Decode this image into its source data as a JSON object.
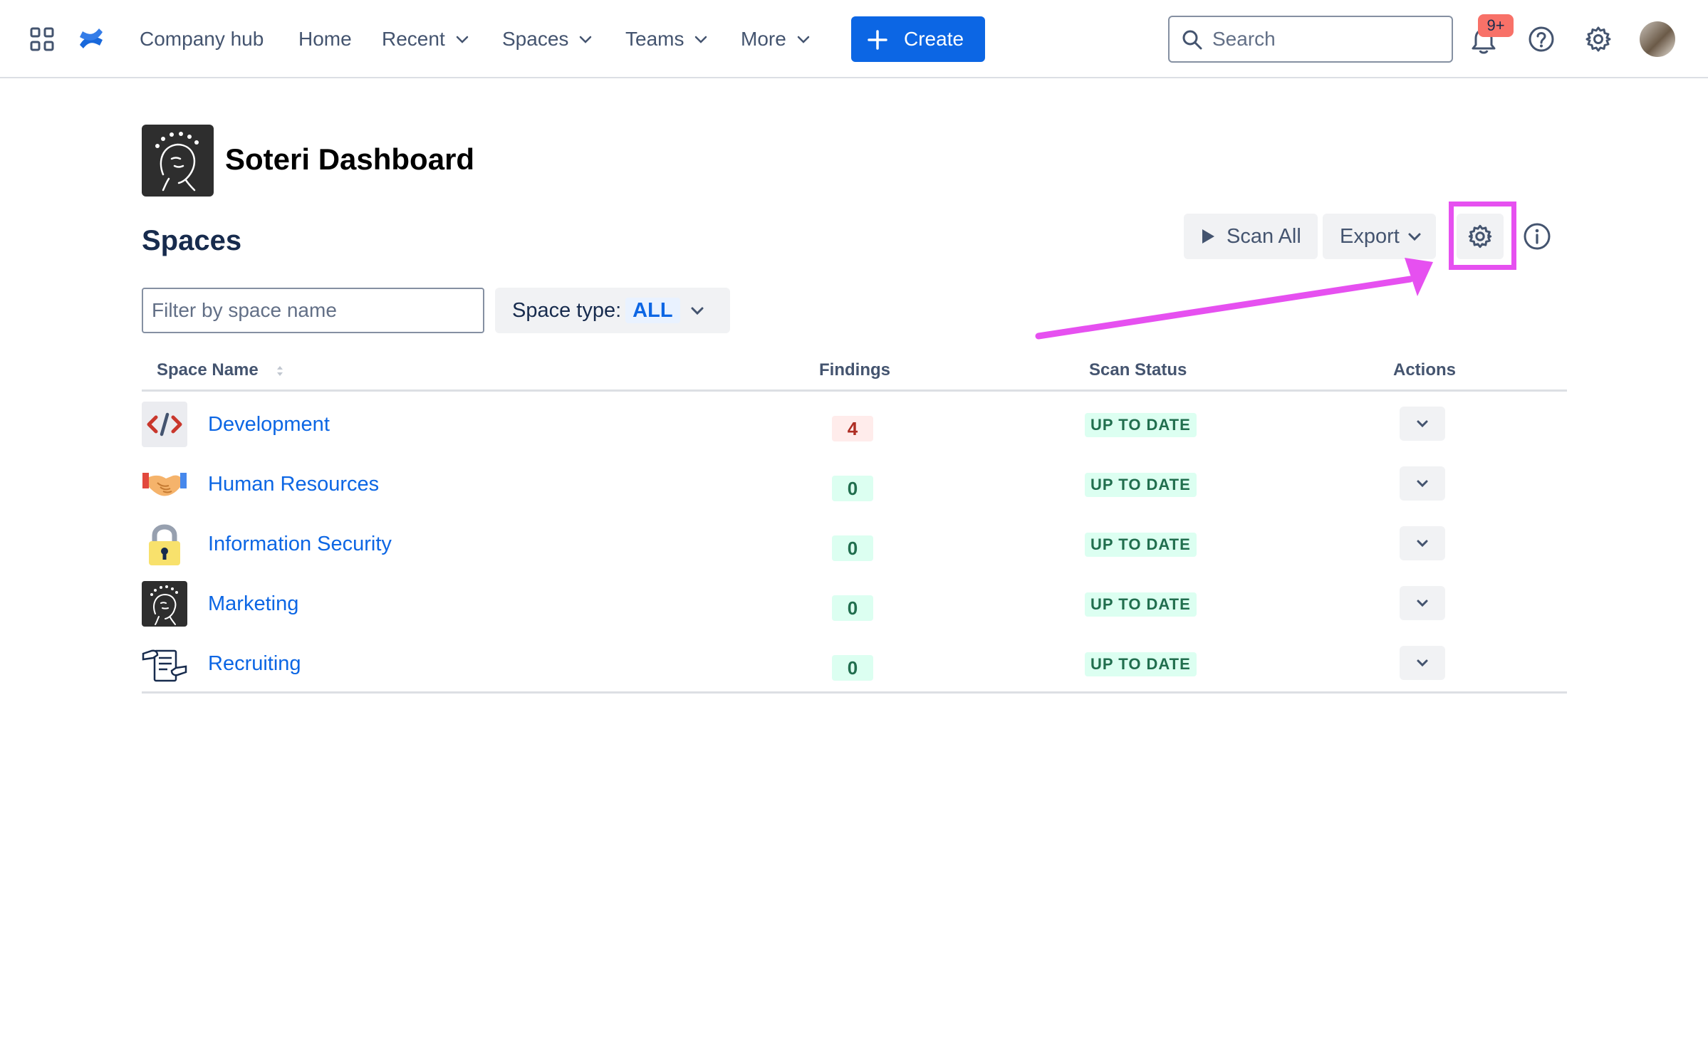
{
  "nav": {
    "app_switcher_icon": "grid-icon",
    "logo_icon": "confluence-logo-icon",
    "links": [
      {
        "label": "Company hub",
        "has_chevron": false
      },
      {
        "label": "Home",
        "has_chevron": false
      },
      {
        "label": "Recent",
        "has_chevron": true
      },
      {
        "label": "Spaces",
        "has_chevron": true
      },
      {
        "label": "Teams",
        "has_chevron": true
      },
      {
        "label": "More",
        "has_chevron": true
      }
    ],
    "create_label": "Create",
    "search_placeholder": "Search",
    "notifications_badge": "9+",
    "colors": {
      "primary": "#0c66e4",
      "badge": "#f87168"
    }
  },
  "header": {
    "title": "Soteri Dashboard",
    "section_title": "Spaces",
    "scan_all_label": "Scan All",
    "export_label": "Export"
  },
  "filters": {
    "search_placeholder": "Filter by space name",
    "space_type_label": "Space type:",
    "space_type_value": "ALL"
  },
  "table": {
    "headers": {
      "name": "Space Name",
      "findings": "Findings",
      "status": "Scan Status",
      "actions": "Actions"
    },
    "rows": [
      {
        "name": "Development",
        "icon": "code-icon",
        "findings": "4",
        "findings_severity": "bad",
        "status": "UP TO DATE"
      },
      {
        "name": "Human Resources",
        "icon": "handshake-icon",
        "findings": "0",
        "findings_severity": "ok",
        "status": "UP TO DATE"
      },
      {
        "name": "Information Security",
        "icon": "padlock-icon",
        "findings": "0",
        "findings_severity": "ok",
        "status": "UP TO DATE"
      },
      {
        "name": "Marketing",
        "icon": "soteri-logo-icon",
        "findings": "0",
        "findings_severity": "ok",
        "status": "UP TO DATE"
      },
      {
        "name": "Recruiting",
        "icon": "recruiting-icon",
        "findings": "0",
        "findings_severity": "ok",
        "status": "UP TO DATE"
      }
    ]
  },
  "annotation": {
    "color": "#e650f0",
    "target": "settings-gear-button"
  }
}
